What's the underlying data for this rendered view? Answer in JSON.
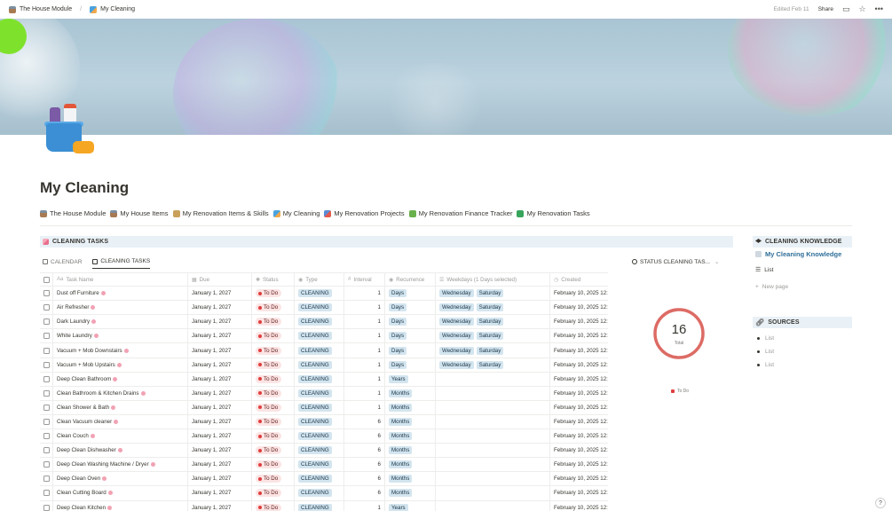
{
  "breadcrumb": {
    "items": [
      {
        "label": "The House Module",
        "icon": "house-icon"
      },
      {
        "label": "My Cleaning",
        "icon": "cleaning-icon"
      }
    ],
    "separator": "/"
  },
  "topbar": {
    "edited": "Edited Feb 11",
    "share": "Share",
    "icons": [
      "comment-icon",
      "star-icon",
      "more-icon"
    ]
  },
  "page": {
    "title": "My Cleaning",
    "icon": "cleaning-supplies-icon"
  },
  "nav_links": [
    "The House Module",
    "My House Items",
    "My Renovation Items & Skills",
    "My Cleaning",
    "My Renovation Projects",
    "My Renovation Finance Tracker",
    "My Renovation Tasks"
  ],
  "cleaning_tasks": {
    "header": "CLEANING TASKS",
    "tabs": [
      {
        "label": "CALENDAR",
        "active": false
      },
      {
        "label": "CLEANING TASKS",
        "active": true
      }
    ],
    "columns": [
      "Task Name",
      "Due",
      "Status",
      "Type",
      "Interval",
      "Recurrence",
      "Weekdays (1 Days selected)",
      "Created"
    ],
    "rows": [
      {
        "name": "Dust off Furniture",
        "due": "January 1, 2027",
        "status": "To Do",
        "type": "CLEANING",
        "interval": "1",
        "recurrence": "Days",
        "weekdays": [
          "Wednesday",
          "Saturday"
        ],
        "created": "February 10, 2025 12:"
      },
      {
        "name": "Air Refresher",
        "due": "January 1, 2027",
        "status": "To Do",
        "type": "CLEANING",
        "interval": "1",
        "recurrence": "Days",
        "weekdays": [
          "Wednesday",
          "Saturday"
        ],
        "created": "February 10, 2025 12:"
      },
      {
        "name": "Dark Laundry",
        "due": "January 1, 2027",
        "status": "To Do",
        "type": "CLEANING",
        "interval": "1",
        "recurrence": "Days",
        "weekdays": [
          "Wednesday",
          "Saturday"
        ],
        "created": "February 10, 2025 12:"
      },
      {
        "name": "White Laundry",
        "due": "January 1, 2027",
        "status": "To Do",
        "type": "CLEANING",
        "interval": "1",
        "recurrence": "Days",
        "weekdays": [
          "Wednesday",
          "Saturday"
        ],
        "created": "February 10, 2025 12:"
      },
      {
        "name": "Vacuum + Mob Downstairs",
        "due": "January 1, 2027",
        "status": "To Do",
        "type": "CLEANING",
        "interval": "1",
        "recurrence": "Days",
        "weekdays": [
          "Wednesday",
          "Saturday"
        ],
        "created": "February 10, 2025 12:"
      },
      {
        "name": "Vacuum + Mob Upstairs",
        "due": "January 1, 2027",
        "status": "To Do",
        "type": "CLEANING",
        "interval": "1",
        "recurrence": "Days",
        "weekdays": [
          "Wednesday",
          "Saturday"
        ],
        "created": "February 10, 2025 12:"
      },
      {
        "name": "Deep Clean Bathroom",
        "due": "January 1, 2027",
        "status": "To Do",
        "type": "CLEANING",
        "interval": "1",
        "recurrence": "Years",
        "weekdays": [],
        "created": "February 10, 2025 12:"
      },
      {
        "name": "Clean Bathroom & Kitchen Drains",
        "due": "January 1, 2027",
        "status": "To Do",
        "type": "CLEANING",
        "interval": "1",
        "recurrence": "Months",
        "weekdays": [],
        "created": "February 10, 2025 12:"
      },
      {
        "name": "Clean Shower & Bath",
        "due": "January 1, 2027",
        "status": "To Do",
        "type": "CLEANING",
        "interval": "1",
        "recurrence": "Months",
        "weekdays": [],
        "created": "February 10, 2025 12:"
      },
      {
        "name": "Clean Vacuum cleaner",
        "due": "January 1, 2027",
        "status": "To Do",
        "type": "CLEANING",
        "interval": "6",
        "recurrence": "Months",
        "weekdays": [],
        "created": "February 10, 2025 12:"
      },
      {
        "name": "Clean Couch",
        "due": "January 1, 2027",
        "status": "To Do",
        "type": "CLEANING",
        "interval": "6",
        "recurrence": "Months",
        "weekdays": [],
        "created": "February 10, 2025 12:"
      },
      {
        "name": "Deep Clean Dishwasher",
        "due": "January 1, 2027",
        "status": "To Do",
        "type": "CLEANING",
        "interval": "6",
        "recurrence": "Months",
        "weekdays": [],
        "created": "February 10, 2025 12:"
      },
      {
        "name": "Deep Clean Washing Machine / Dryer",
        "due": "January 1, 2027",
        "status": "To Do",
        "type": "CLEANING",
        "interval": "6",
        "recurrence": "Months",
        "weekdays": [],
        "created": "February 10, 2025 12:"
      },
      {
        "name": "Deep Clean Oven",
        "due": "January 1, 2027",
        "status": "To Do",
        "type": "CLEANING",
        "interval": "6",
        "recurrence": "Months",
        "weekdays": [],
        "created": "February 10, 2025 12:"
      },
      {
        "name": "Clean Cutting Board",
        "due": "January 1, 2027",
        "status": "To Do",
        "type": "CLEANING",
        "interval": "6",
        "recurrence": "Months",
        "weekdays": [],
        "created": "February 10, 2025 12:"
      },
      {
        "name": "Deep Clean Kitchen",
        "due": "January 1, 2027",
        "status": "To Do",
        "type": "CLEANING",
        "interval": "1",
        "recurrence": "Years",
        "weekdays": [],
        "created": "February 10, 2025 12:"
      }
    ]
  },
  "status_chart": {
    "title": "STATUS CLEANING TAS...",
    "total_value": "16",
    "total_label": "Total",
    "legend": [
      {
        "label": "To Do",
        "color": "#e03e3e"
      }
    ],
    "ring_color": "#dd6b65"
  },
  "knowledge": {
    "header": "CLEANING KNOWLEDGE",
    "link": "My Cleaning Knowledge",
    "view": "List",
    "new_page": "New page"
  },
  "sources": {
    "header": "SOURCES",
    "items": [
      "List",
      "List",
      "List"
    ]
  },
  "help": "?"
}
